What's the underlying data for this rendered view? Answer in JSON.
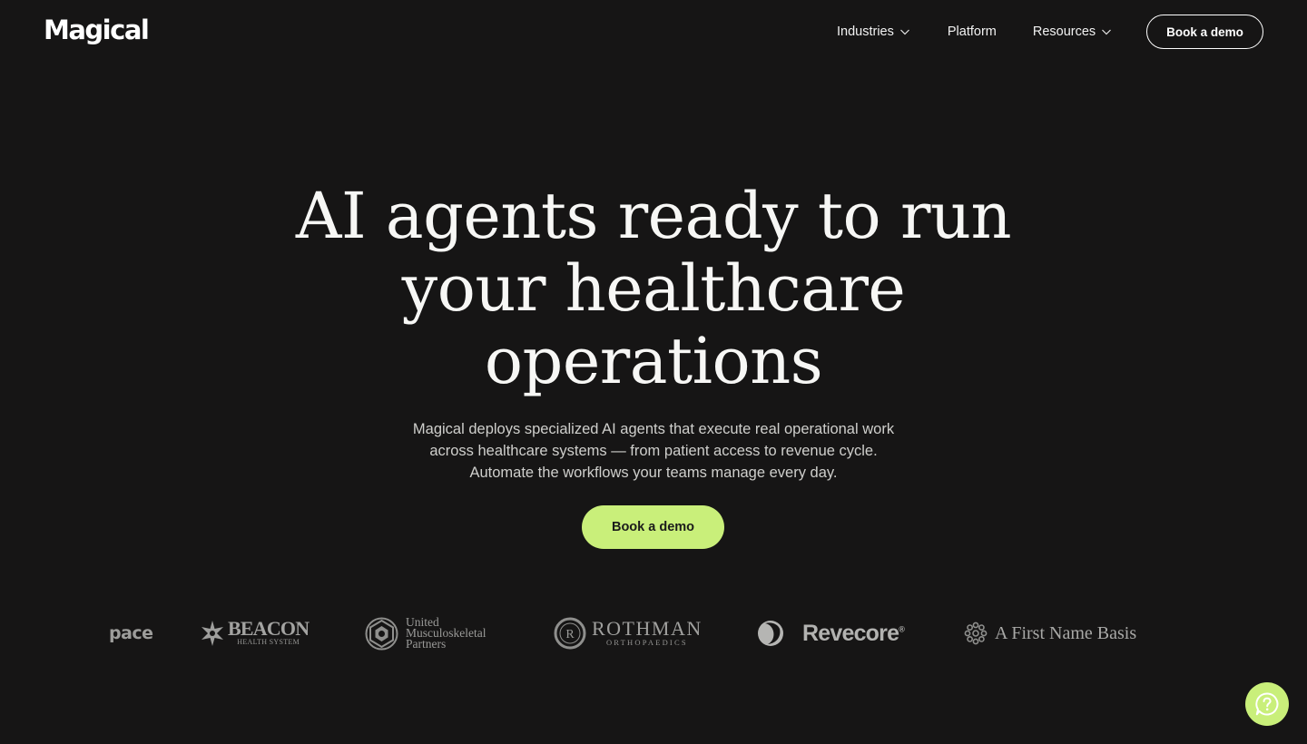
{
  "brand": {
    "logo_text": "Magical"
  },
  "nav": {
    "items": [
      {
        "label": "Industries",
        "has_dropdown": true
      },
      {
        "label": "Platform",
        "has_dropdown": false
      },
      {
        "label": "Resources",
        "has_dropdown": true
      }
    ],
    "cta_label": "Book a demo"
  },
  "hero": {
    "title_lines": [
      "AI agents ready to run",
      "your healthcare",
      "operations"
    ],
    "subtitle_lines": [
      "Magical deploys specialized AI agents that execute real operational work",
      "across healthcare systems — from patient access to revenue cycle.",
      "Automate the workflows your teams manage every day."
    ],
    "cta_label": "Book a demo"
  },
  "customer_logos": {
    "space_partial": "pace",
    "beacon": {
      "name": "BEACON",
      "tagline": "HEALTH SYSTEM"
    },
    "ump": {
      "lines": [
        "United",
        "Musculoskeletal",
        "Partners"
      ]
    },
    "rothman": {
      "name": "ROTHMAN",
      "tagline": "ORTHOPAEDICS",
      "monogram": "R"
    },
    "revecore": {
      "name": "Revecore",
      "mark": "®"
    },
    "first_name_basis": {
      "name": "A First Name Basis"
    }
  },
  "colors": {
    "background": "#161515",
    "accent": "#c9ef7a",
    "text": "#f7f7f5"
  },
  "icons": {
    "nav_dropdown": "chevron-down-icon",
    "help": "help-question-icon"
  }
}
